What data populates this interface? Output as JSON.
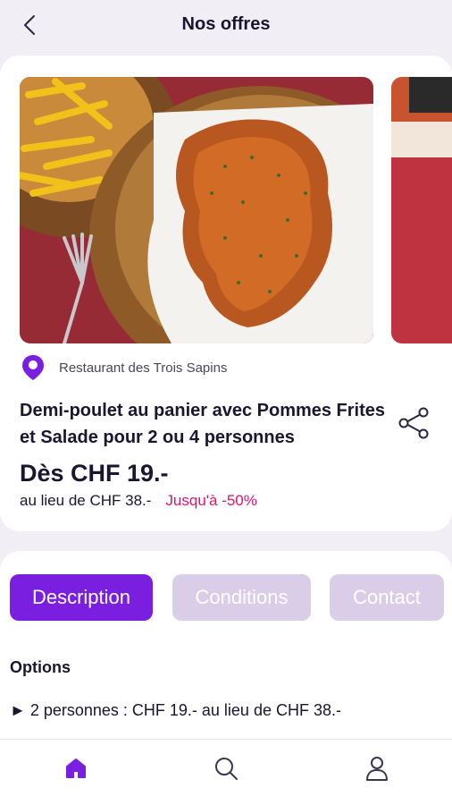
{
  "header": {
    "title": "Nos offres",
    "back_icon": "chevron-left-icon"
  },
  "offer": {
    "image_description_main": "photo",
    "location": "Restaurant des Trois Sapins",
    "title": "Demi-poulet au panier avec Pommes Frites et Salade pour 2 ou 4 personnes",
    "price": "Dès CHF 19.-",
    "original_price": "au lieu de CHF 38.-",
    "discount": "Jusqu'à -50%"
  },
  "tabs": [
    {
      "label": "Description",
      "active": true
    },
    {
      "label": "Conditions",
      "active": false
    },
    {
      "label": "Contact",
      "active": false
    }
  ],
  "options": {
    "title": "Options",
    "items": [
      "► 2 personnes : CHF 19.- au lieu de CHF 38.-"
    ]
  },
  "nav": {
    "items": [
      {
        "icon": "home-icon",
        "active": true
      },
      {
        "icon": "search-icon",
        "active": false
      },
      {
        "icon": "user-icon",
        "active": false
      }
    ]
  },
  "colors": {
    "accent": "#7a1fe0",
    "tab_inactive": "#d9cde8",
    "discount": "#e0126a",
    "background": "#f1eef5"
  }
}
